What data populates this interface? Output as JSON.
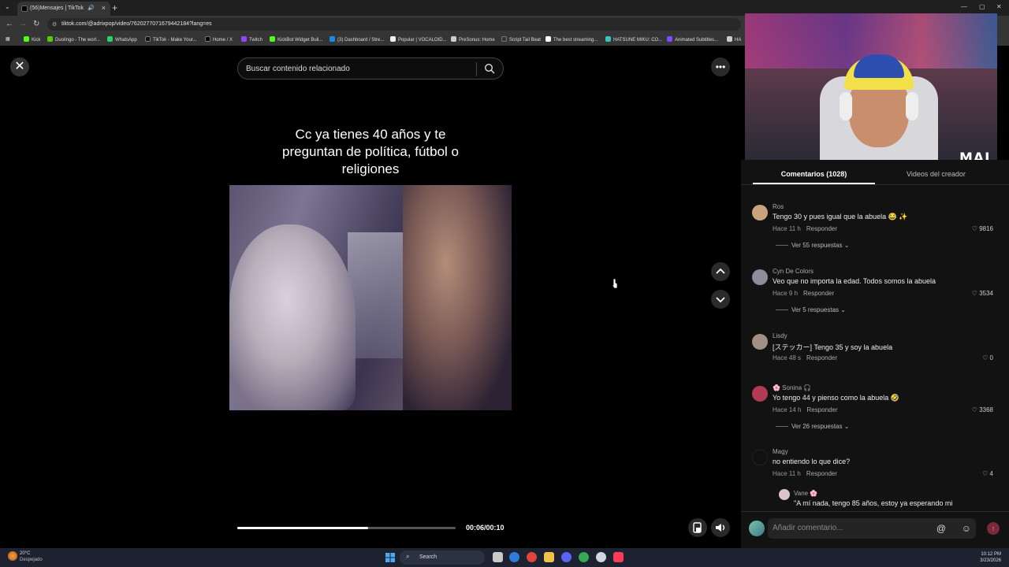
{
  "browser": {
    "tab_title": "(56)Mensajes | TikTok",
    "new_tab": "+",
    "url": "tiktok.com/@adrixpop/video/7620277071679442184?lang=es",
    "bookmarks": [
      {
        "label": "Kick",
        "color": "#53fc18"
      },
      {
        "label": "Duolingo - The worl...",
        "color": "#58cc02"
      },
      {
        "label": "WhatsApp",
        "color": "#25d366"
      },
      {
        "label": "TikTok - Make Your...",
        "color": "#111111"
      },
      {
        "label": "Home / X",
        "color": "#000000"
      },
      {
        "label": "Twitch",
        "color": "#9146ff"
      },
      {
        "label": "KickBot Widget Buil...",
        "color": "#53fc18"
      },
      {
        "label": "(3) Dashboard / Stre...",
        "color": "#1e88e5"
      },
      {
        "label": "Popular | VOCALOID...",
        "color": "#eeeeee"
      },
      {
        "label": "PreSonus: Home",
        "color": "#cccccc"
      },
      {
        "label": "Script Tail Beat",
        "color": "#333333"
      },
      {
        "label": "The best streaming...",
        "color": "#ffffff"
      },
      {
        "label": "HATSUNE MIKU: CO...",
        "color": "#39c5bb"
      },
      {
        "label": "Animated Subtitles...",
        "color": "#7c4dff"
      },
      {
        "label": "HA",
        "color": "#cccccc"
      }
    ]
  },
  "video": {
    "search_placeholder": "Buscar contenido relacionado",
    "caption": "Cc ya tienes 40 años y te preguntan de política, fútbol o religiones",
    "progress": 0.6,
    "time": "00:06/00:10"
  },
  "overlay": {
    "logo": "MAI"
  },
  "comments_panel": {
    "tab_comments": "Comentarios (1028)",
    "tab_creator": "Videos del creador",
    "reply_label": "Responder",
    "comments": [
      {
        "user": "Ros",
        "text": "Tengo 30 y pues igual que la abuela 😂 ✨",
        "time": "Hace 11 h",
        "likes": "9816",
        "more": "Ver 55 respuestas",
        "avatar_color": "#c9a27e"
      },
      {
        "user": "Cyn De Colors",
        "text": "Veo que no importa la edad. Todos somos la abuela",
        "time": "Hace 9 h",
        "likes": "3534",
        "more": "Ver 5 respuestas",
        "avatar_color": "#8d8d99"
      },
      {
        "user": "Lisdy",
        "text": "[ステッカー] Tengo 35 y soy la abuela",
        "time": "Hace 48 s",
        "likes": "0",
        "more": "",
        "avatar_color": "#a08f84"
      },
      {
        "user": "🌸 Sonina 🎧",
        "text": "Yo tengo 44 y pienso como la abuela 🤣",
        "time": "Hace 14 h",
        "likes": "3368",
        "more": "Ver 26 respuestas",
        "avatar_color": "#b23a52"
      },
      {
        "user": "Magy",
        "text": "no entiendo lo que dice?",
        "time": "Hace 11 h",
        "likes": "4",
        "more": "",
        "avatar_color": "#111111"
      }
    ],
    "subreply": {
      "user": "Vane 🌸",
      "text": "\"A mí nada, tengo 85 años, estoy ya esperando mi"
    },
    "composer_placeholder": "Añadir comentario...",
    "at_symbol": "@"
  },
  "taskbar": {
    "temp": "20°C",
    "weather": "Despejado",
    "search": "Search",
    "time": "10:12 PM",
    "date": "3/23/2026"
  }
}
